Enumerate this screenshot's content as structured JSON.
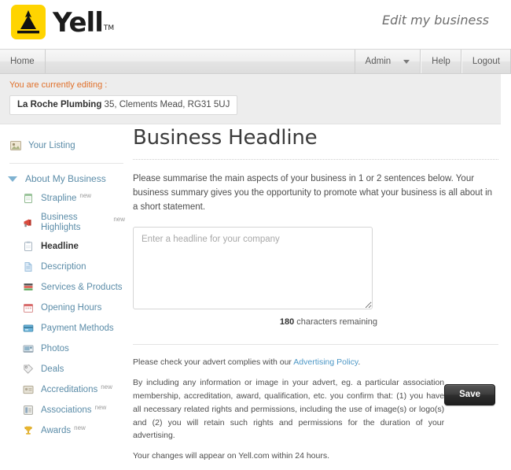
{
  "header": {
    "logo_text": "Yell",
    "logo_tm": "TM",
    "logo_icon": "yell-arrow-logo-icon",
    "tagline": "Edit my business"
  },
  "navbar": {
    "left_items": [
      {
        "label": "Home",
        "name": "nav-item-home"
      }
    ],
    "right_items": [
      {
        "label": "Admin",
        "name": "nav-item-admin",
        "has_caret": true
      },
      {
        "label": "Help",
        "name": "nav-item-help",
        "has_caret": false
      },
      {
        "label": "Logout",
        "name": "nav-item-logout",
        "has_caret": false
      }
    ]
  },
  "editing": {
    "label": "You are currently editing :",
    "business_name": "La Roche Plumbing",
    "business_address": "35, Clements Mead, RG31 5UJ"
  },
  "sidebar": {
    "top_item": {
      "label": "Your Listing",
      "icon": "listing-card-icon"
    },
    "group": {
      "label": "About My Business",
      "icon": "triangle-down-icon"
    },
    "items": [
      {
        "label": "Strapline",
        "icon": "note-icon",
        "badge": "new",
        "active": false
      },
      {
        "label": "Business Highlights",
        "icon": "megaphone-icon",
        "badge": "new",
        "active": false
      },
      {
        "label": "Headline",
        "icon": "clipboard-icon",
        "badge": "",
        "active": true
      },
      {
        "label": "Description",
        "icon": "document-icon",
        "badge": "",
        "active": false
      },
      {
        "label": "Services & Products",
        "icon": "stack-icon",
        "badge": "",
        "active": false
      },
      {
        "label": "Opening Hours",
        "icon": "calendar-icon",
        "badge": "",
        "active": false
      },
      {
        "label": "Payment Methods",
        "icon": "card-icon",
        "badge": "",
        "active": false
      },
      {
        "label": "Photos",
        "icon": "photo-icon",
        "badge": "",
        "active": false
      },
      {
        "label": "Deals",
        "icon": "tag-icon",
        "badge": "",
        "active": false
      },
      {
        "label": "Accreditations",
        "icon": "certificate-icon",
        "badge": "new",
        "active": false
      },
      {
        "label": "Associations",
        "icon": "association-icon",
        "badge": "new",
        "active": false
      },
      {
        "label": "Awards",
        "icon": "trophy-icon",
        "badge": "new",
        "active": false
      }
    ]
  },
  "main": {
    "title": "Business Headline",
    "intro": "Please summarise the main aspects of your business in 1 or 2 sentences below. Your business summary gives you the opportunity to promote what your business is all about in a short statement.",
    "headline_value": "",
    "headline_placeholder": "Enter a headline for your company",
    "chars_remaining": "180",
    "chars_remaining_suffix": "characters remaining"
  },
  "legal": {
    "line1_prefix": "Please check your advert complies with our ",
    "line1_link": "Advertising Policy",
    "line1_suffix": ".",
    "line2": "By including any information or image in your advert, eg. a particular association membership, accreditation, award, qualification, etc. you confirm that: (1) you have all necessary related rights and permissions, including the use of image(s) or logo(s) and (2) you will retain such rights and permissions for the duration of your advertising.",
    "line3": "Your changes will appear on Yell.com within 24 hours."
  },
  "actions": {
    "save_label": "Save"
  },
  "colors": {
    "brand_yellow": "#ffd400",
    "link_blue": "#4c97c6",
    "sidebar_link": "#5b8ca8",
    "editing_orange": "#e0702a",
    "save_dark": "#2e2e2e"
  }
}
